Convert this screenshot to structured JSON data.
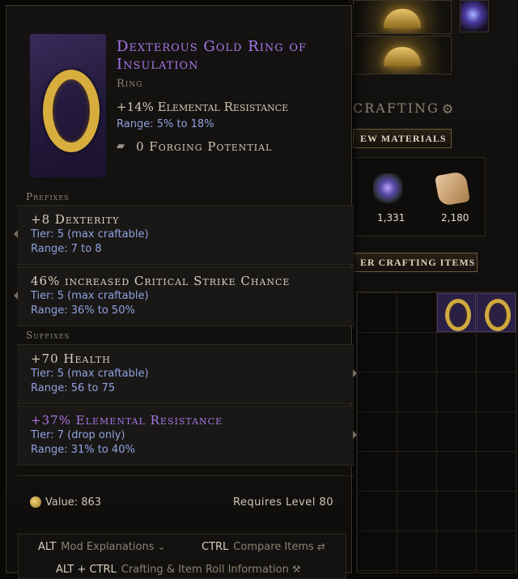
{
  "crafting": {
    "title": "CRAFTING",
    "view_materials": "EW MATERIALS",
    "other_items": "ER CRAFTING ITEMS",
    "materials": [
      {
        "icon": "rune-shard-icon",
        "count": "1,331"
      },
      {
        "icon": "scroll-icon",
        "count": "2,180"
      }
    ]
  },
  "tooltip": {
    "name": "Dexterous Gold Ring of Insulation",
    "type": "Ring",
    "implicit": "+14% Elemental Resistance",
    "implicit_range": "Range: 5% to 18%",
    "forging_potential": "0 Forging Potential",
    "prefixes_label": "Prefixes",
    "suffixes_label": "Suffixes",
    "prefixes": [
      {
        "name": "+8 Dexterity",
        "tier": "Tier: 5 (max craftable)",
        "range": "Range: 7 to 8"
      },
      {
        "name": "46% increased Critical Strike Chance",
        "tier": "Tier: 5 (max craftable)",
        "range": "Range: 36% to 50%"
      }
    ],
    "suffixes": [
      {
        "name": "+70 Health",
        "tier": "Tier: 5 (max craftable)",
        "range": "Range: 56 to 75"
      },
      {
        "name": "+37% Elemental Resistance",
        "tier": "Tier: 7 (drop only)",
        "range": "Range: 31% to 40%"
      }
    ],
    "value": "Value: 863",
    "requires_level": "Requires Level 80",
    "hints": {
      "alt_key": "ALT",
      "alt_label": "Mod Explanations",
      "ctrl_key": "CTRL",
      "ctrl_label": "Compare Items",
      "altctrl_key": "ALT + CTRL",
      "altctrl_label": "Crafting & Item Roll Information"
    }
  },
  "colors": {
    "exalted_purple": "#a877e8",
    "range_blue": "#8fa2e0",
    "gold": "#d7ad3e"
  }
}
